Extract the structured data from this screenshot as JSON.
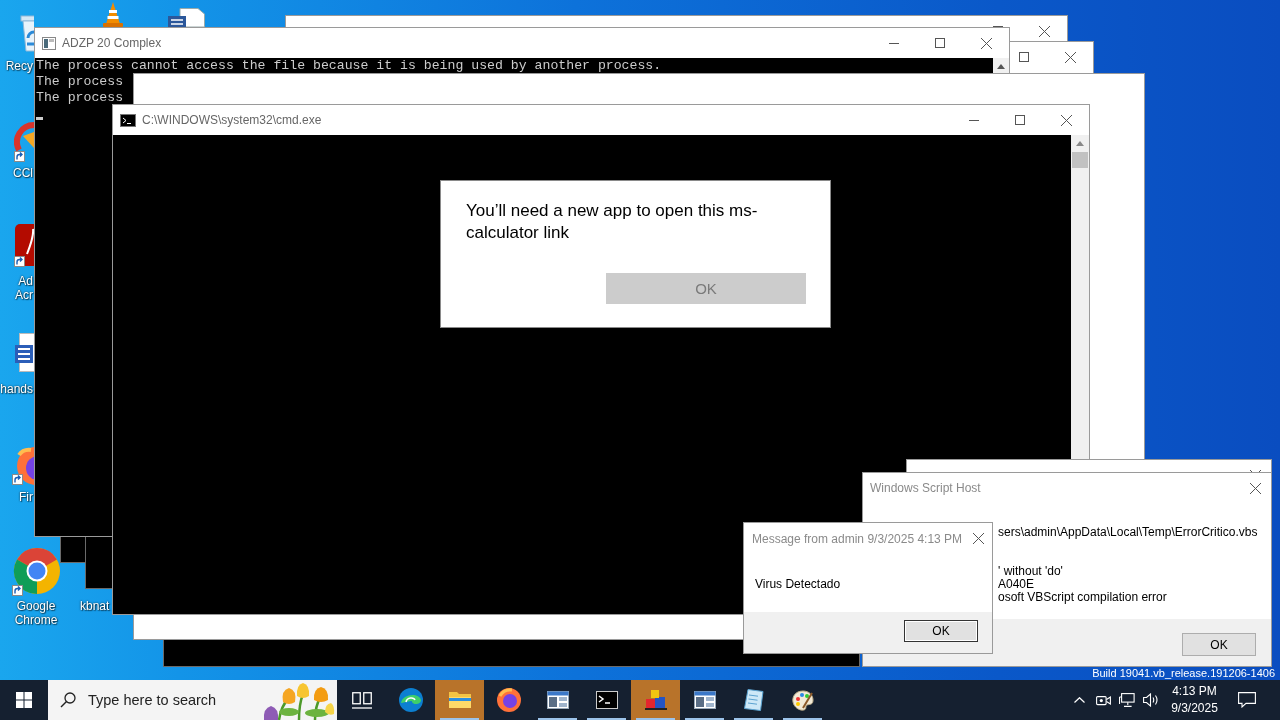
{
  "desktop": {
    "icons": [
      {
        "kind": "recycle",
        "label": "Recy"
      },
      {
        "kind": "cone"
      },
      {
        "kind": "document"
      },
      {
        "kind": "cleaner",
        "label": "CCl"
      },
      {
        "kind": "acrobat",
        "label": "Ad\nAcr"
      },
      {
        "kind": "word",
        "label": "hands"
      },
      {
        "kind": "firefox",
        "label": "Fir"
      },
      {
        "kind": "chrome",
        "label": "Google\nChrome"
      },
      {
        "kind": "covered",
        "label": "kbnat"
      }
    ],
    "build_info": "Build 19041.vb_release.191206-1406"
  },
  "windows": [
    {
      "kind": "fragment"
    },
    {
      "kind": "fragment"
    },
    {
      "kind": "fragment"
    },
    {
      "kind": "frame"
    },
    {
      "kind": "frame"
    },
    {
      "kind": "console",
      "title": "ADZP 20 Complex",
      "lines": [
        "The process cannot access the file because it is being used by another process.",
        "The process",
        "The process"
      ]
    },
    {
      "kind": "blank"
    },
    {
      "kind": "terminal",
      "title": "C:\\WINDOWS\\system32\\cmd.exe"
    },
    {
      "kind": "prompt",
      "message": "You’ll need a new app to open this ms-calculator link",
      "button": {
        "label": "OK",
        "disabled": true
      }
    },
    {
      "kind": "dialog"
    },
    {
      "kind": "dialog",
      "title": "Windows Script Host",
      "blocks": [
        [
          "sers\\admin\\AppData\\Local\\Temp\\ErrorCritico.vbs"
        ],
        [
          "' without 'do'",
          "A040E",
          "osoft VBScript compilation error"
        ]
      ],
      "button": "OK"
    },
    {
      "kind": "message",
      "title": "Message from admin 9/3/2025 4:13 PM",
      "message": "Virus Detectado",
      "button": "OK"
    }
  ],
  "taskbar": {
    "search": {
      "placeholder": "Type here to search"
    },
    "apps": [
      {
        "kind": "taskview",
        "running": false,
        "flashing": false
      },
      {
        "kind": "edge",
        "running": false,
        "flashing": false
      },
      {
        "kind": "explorer",
        "running": true,
        "flashing": true
      },
      {
        "kind": "firefox",
        "running": false,
        "flashing": false
      },
      {
        "kind": "window",
        "running": true,
        "flashing": false
      },
      {
        "kind": "terminal",
        "running": true,
        "flashing": false
      },
      {
        "kind": "blocks",
        "running": true,
        "flashing": true
      },
      {
        "kind": "window",
        "running": true,
        "flashing": false
      },
      {
        "kind": "notepad",
        "running": true,
        "flashing": false
      },
      {
        "kind": "paint",
        "running": true,
        "flashing": false
      }
    ],
    "tray": {
      "time": "4:13 PM",
      "date": "9/3/2025"
    }
  }
}
